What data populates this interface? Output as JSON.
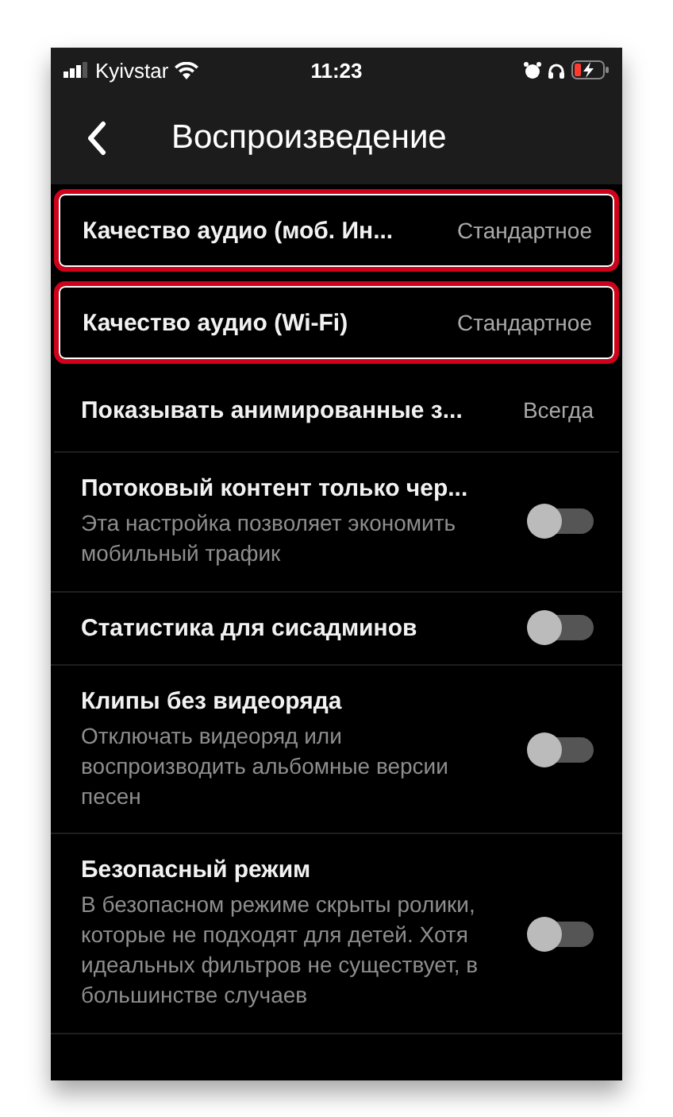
{
  "status_bar": {
    "carrier": "Kyivstar",
    "time": "11:23"
  },
  "header": {
    "title": "Воспроизведение"
  },
  "settings": [
    {
      "kind": "value",
      "title": "Качество аудио (моб. Ин...",
      "value": "Стандартное",
      "highlighted": true
    },
    {
      "kind": "value",
      "title": "Качество аудио (Wi-Fi)",
      "value": "Стандартное",
      "highlighted": true
    },
    {
      "kind": "value",
      "title": "Показывать анимированные з...",
      "value": "Всегда",
      "highlighted": false
    },
    {
      "kind": "toggle",
      "title": "Потоковый контент только чер...",
      "description": "Эта настройка позволяет экономить мобильный трафик",
      "on": false
    },
    {
      "kind": "toggle",
      "title": "Статистика для сисадминов",
      "on": false
    },
    {
      "kind": "toggle",
      "title": "Клипы без видеоряда",
      "description": "Отключать видеоряд или воспроизводить альбомные версии песен",
      "on": false
    },
    {
      "kind": "toggle",
      "title": "Безопасный режим",
      "description": "В безопасном режиме скрыты ролики, которые не подходят для детей. Хотя идеальных фильтров не существует, в большинстве случаев",
      "on": false
    }
  ]
}
